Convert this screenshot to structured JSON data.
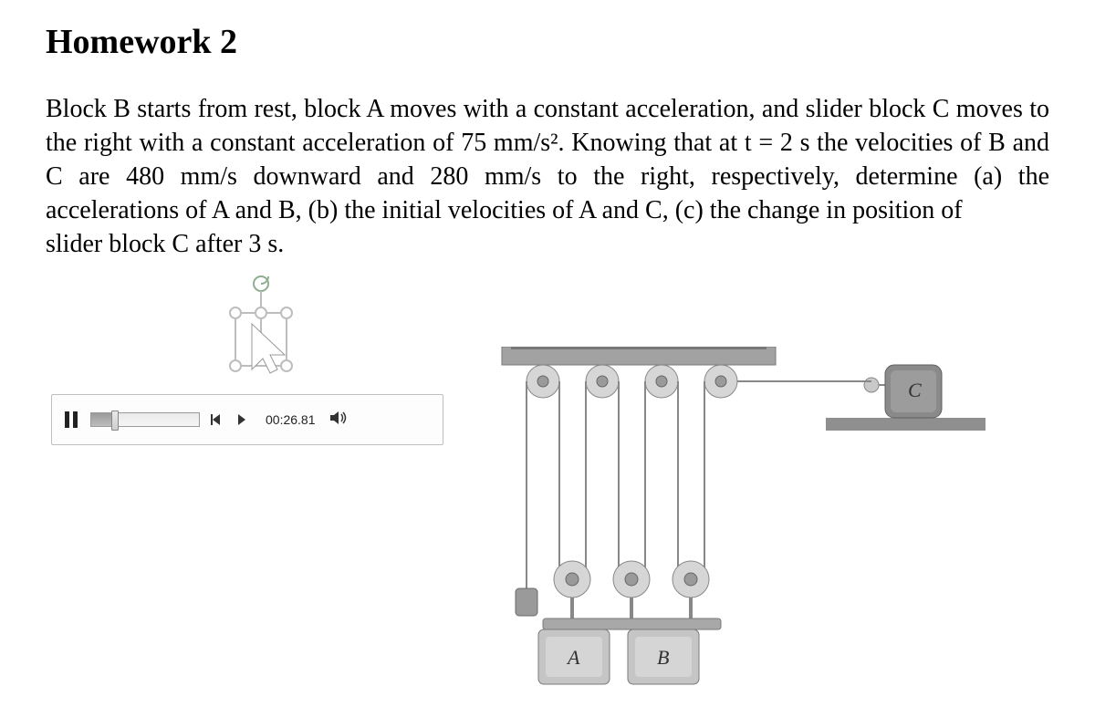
{
  "title": "Homework 2",
  "problem": "Block B starts from rest, block A moves with a constant acceleration, and slider block C moves to the right with a constant acceleration of 75 mm/s². Knowing that at t = 2 s the velocities of B and C are 480 mm/s downward and 280 mm/s to the right, respectively, determine (a) the accelerations of A and B, (b) the initial velocities of A and C, (c) the change in position of",
  "problem_tail": "slider block C after 3 s.",
  "player": {
    "time": "00:26.81"
  },
  "diagram": {
    "label_A": "A",
    "label_B": "B",
    "label_C": "C"
  }
}
